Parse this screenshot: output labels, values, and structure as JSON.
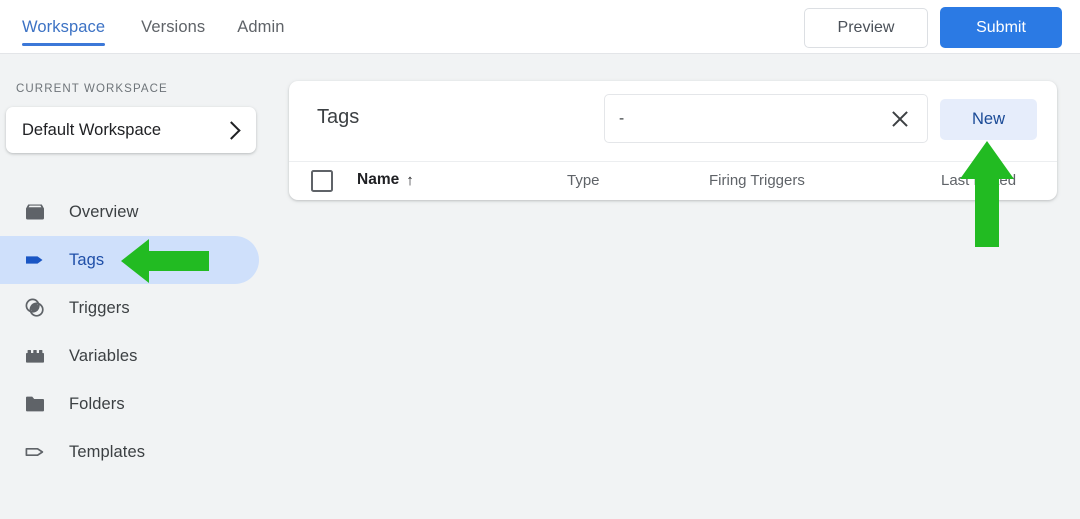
{
  "topbar": {
    "tabs": [
      {
        "label": "Workspace",
        "active": true
      },
      {
        "label": "Versions",
        "active": false
      },
      {
        "label": "Admin",
        "active": false
      }
    ],
    "preview_label": "Preview",
    "submit_label": "Submit",
    "accent_color": "#2b7ae4",
    "active_tab_color": "#3c72c4"
  },
  "sidebar": {
    "workspace_section_label": "CURRENT WORKSPACE",
    "workspace_name": "Default Workspace",
    "workspace_chevron_icon": "chevron-right-icon",
    "items": [
      {
        "label": "Overview",
        "icon": "overview-box-icon",
        "active": false
      },
      {
        "label": "Tags",
        "icon": "tag-icon",
        "active": true
      },
      {
        "label": "Triggers",
        "icon": "triggers-circles-icon",
        "active": false
      },
      {
        "label": "Variables",
        "icon": "variables-brick-icon",
        "active": false
      },
      {
        "label": "Folders",
        "icon": "folder-icon",
        "active": false
      },
      {
        "label": "Templates",
        "icon": "template-tag-outline-icon",
        "active": false
      }
    ],
    "active_item_bg": "#cfe0fb",
    "active_icon_color": "#1a56c4"
  },
  "main": {
    "card_title": "Tags",
    "search": {
      "value": "-",
      "placeholder": "",
      "clear_icon": "close-x-icon"
    },
    "new_button_label": "New",
    "new_button_bg": "#e6edfb",
    "table": {
      "select_all_checkbox": "checkbox-unchecked-icon",
      "columns": [
        {
          "label": "Name",
          "sort_indicator": "↑"
        },
        {
          "label": "Type",
          "sort_indicator": ""
        },
        {
          "label": "Firing Triggers",
          "sort_indicator": ""
        },
        {
          "label": "Last Edited",
          "sort_indicator": ""
        }
      ],
      "rows": []
    }
  },
  "annotations": {
    "color": "#22bb22",
    "arrows": [
      {
        "name": "arrow-pointing-to-tags",
        "direction": "left"
      },
      {
        "name": "arrow-pointing-to-new-button",
        "direction": "up"
      }
    ]
  }
}
